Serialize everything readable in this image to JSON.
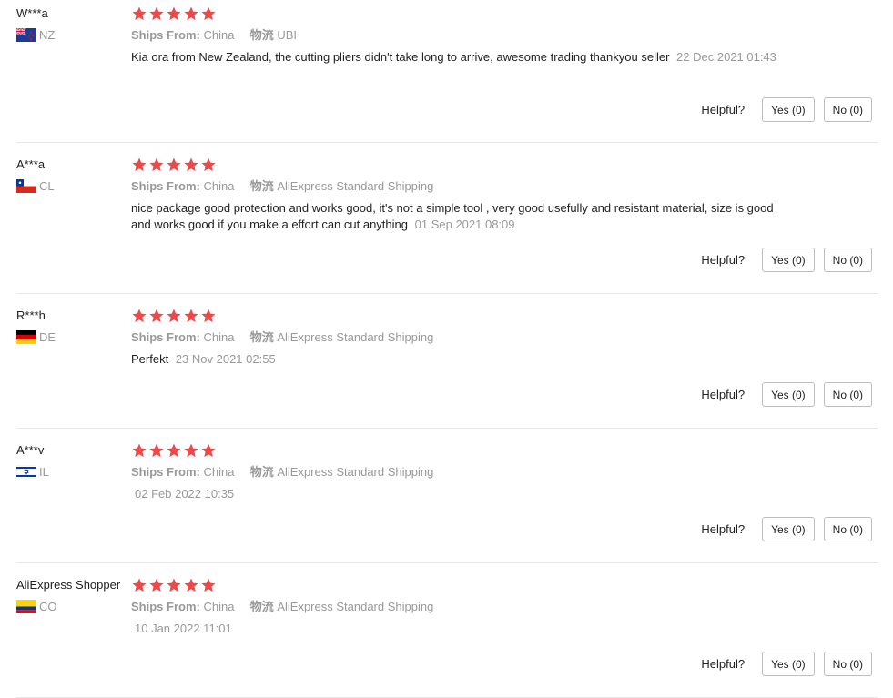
{
  "labels": {
    "ships_from": "Ships From:",
    "logistics": "物流",
    "helpful": "Helpful?"
  },
  "colors": {
    "star": "#f04848",
    "muted": "#999999"
  },
  "reviews": [
    {
      "user": "W***a",
      "country": "NZ",
      "flag": "nz-flag-icon",
      "rating": 5,
      "ships_from": "China",
      "logistics": "UBI",
      "text": "Kia ora from New Zealand, the cutting pliers didn't take long to arrive, awesome trading thankyou seller",
      "date": "22 Dec 2021 01:43",
      "yes": "Yes (0)",
      "no": "No (0)"
    },
    {
      "user": "A***a",
      "country": "CL",
      "flag": "cl-flag-icon",
      "rating": 5,
      "ships_from": "China",
      "logistics": "AliExpress Standard Shipping",
      "text": "nice package good protection and works good, it's not a simple tool , very good usefully and resistant material, size is good and works good if you make a effort can cut anything",
      "date": "01 Sep 2021 08:09",
      "yes": "Yes (0)",
      "no": "No (0)"
    },
    {
      "user": "R***h",
      "country": "DE",
      "flag": "de-flag-icon",
      "rating": 5,
      "ships_from": "China",
      "logistics": "AliExpress Standard Shipping",
      "text": "Perfekt",
      "date": "23 Nov 2021 02:55",
      "yes": "Yes (0)",
      "no": "No (0)"
    },
    {
      "user": "A***v",
      "country": "IL",
      "flag": "il-flag-icon",
      "rating": 5,
      "ships_from": "China",
      "logistics": "AliExpress Standard Shipping",
      "text": "",
      "date": "02 Feb 2022 10:35",
      "yes": "Yes (0)",
      "no": "No (0)"
    },
    {
      "user": "AliExpress Shopper",
      "country": "CO",
      "flag": "co-flag-icon",
      "rating": 5,
      "ships_from": "China",
      "logistics": "AliExpress Standard Shipping",
      "text": "",
      "date": "10 Jan 2022 11:01",
      "yes": "Yes (0)",
      "no": "No (0)"
    }
  ]
}
